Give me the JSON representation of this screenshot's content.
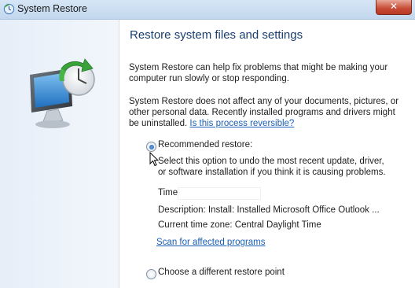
{
  "window": {
    "title": "System Restore",
    "close_glyph": "✕"
  },
  "main": {
    "heading": "Restore system files and settings",
    "paragraph1": "System Restore can help fix problems that might be making your computer run slowly or stop responding.",
    "paragraph2": "System Restore does not affect any of your documents, pictures, or other personal data. Recently installed programs and drivers might be uninstalled.",
    "reversible_link": "Is this process reversible?",
    "options": {
      "recommended": {
        "label": "Recommended restore:",
        "selected": true,
        "description": "Select this option to undo the most recent update, driver, or software installation if you think it is causing problems.",
        "time_label": "Time:",
        "time_value": "",
        "description_line": "Description: Install: Installed Microsoft Office Outlook ...",
        "timezone_line": "Current time zone: Central Daylight Time",
        "scan_link": "Scan for affected programs"
      },
      "different": {
        "label": "Choose a different restore point",
        "selected": false
      }
    }
  },
  "colors": {
    "heading": "#1a3e6f",
    "link": "#1a5fb4",
    "left_pane": "#e9f0f8"
  }
}
